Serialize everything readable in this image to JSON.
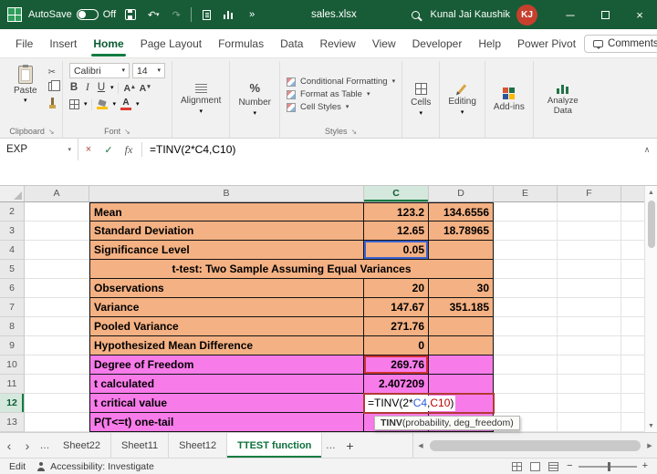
{
  "colors": {
    "titlebar_green": "#185C37",
    "accent_green": "#107C41",
    "orange_fill": "#F4B183",
    "pink_fill": "#F87BEA",
    "reference_blue": "#2E5BD7",
    "reference_red": "#C00000",
    "edit_border_red": "#B03A34",
    "avatar_red": "#C7402D"
  },
  "titlebar": {
    "autosave_label": "AutoSave",
    "autosave_state": "Off",
    "filename": "sales.xlsx",
    "user_name": "Kunal Jai Kaushik",
    "user_initials": "KJ"
  },
  "menubar": {
    "tabs": [
      "File",
      "Insert",
      "Home",
      "Page Layout",
      "Formulas",
      "Data",
      "Review",
      "View",
      "Developer",
      "Help",
      "Power Pivot"
    ],
    "active_tab": "Home",
    "comments_label": "Comments"
  },
  "ribbon": {
    "paste_label": "Paste",
    "clipboard_group_label": "Clipboard",
    "font_name": "Calibri",
    "font_size": "14",
    "bold_label": "B",
    "italic_label": "I",
    "underline_label": "U",
    "font_group_label": "Font",
    "alignment_label": "Alignment",
    "number_label": "Number",
    "percent_icon": "%",
    "styles_items": [
      "Conditional Formatting",
      "Format as Table",
      "Cell Styles"
    ],
    "styles_group_label": "Styles",
    "cells_label": "Cells",
    "editing_label": "Editing",
    "addins_label": "Add-ins",
    "addins_group_label": "Add-ins",
    "analyze_label": "Analyze Data"
  },
  "formula_bar": {
    "name_box": "EXP",
    "formula": "=TINV(2*C4,C10)"
  },
  "grid": {
    "column_headers": [
      "A",
      "B",
      "C",
      "D",
      "E",
      "F"
    ],
    "active_column": "C",
    "active_row": 12,
    "rows": [
      {
        "n": 2,
        "zone": "orange",
        "b": "Mean",
        "c": "123.2",
        "d": "134.6556"
      },
      {
        "n": 3,
        "zone": "orange",
        "b": "Standard Deviation",
        "c": "12.65",
        "d": "18.78965"
      },
      {
        "n": 4,
        "zone": "orange",
        "b": "Significance Level",
        "c": "0.05",
        "d": "",
        "c_ref": "blue"
      },
      {
        "n": 5,
        "zone": "orange",
        "merged": "t-test: Two Sample Assuming Equal Variances"
      },
      {
        "n": 6,
        "zone": "orange",
        "b": "Observations",
        "c": "20",
        "d": "30"
      },
      {
        "n": 7,
        "zone": "orange",
        "b": "Variance",
        "c": "147.67",
        "d": "351.185"
      },
      {
        "n": 8,
        "zone": "orange",
        "b": "Pooled Variance",
        "c": "271.76",
        "d": ""
      },
      {
        "n": 9,
        "zone": "orange",
        "b": "Hypothesized Mean Difference",
        "c": "0",
        "d": ""
      },
      {
        "n": 10,
        "zone": "pink",
        "b": "Degree of Freedom",
        "c": "269.76",
        "d": "",
        "c_ref": "red"
      },
      {
        "n": 11,
        "zone": "pink",
        "b": "t calculated",
        "c": "2.407209",
        "d": ""
      },
      {
        "n": 12,
        "zone": "pink",
        "b": "t critical value",
        "c": "",
        "d": "",
        "editing": true
      },
      {
        "n": 13,
        "zone": "pink",
        "b": "P(T<=t) one-tail",
        "c": "",
        "d": ""
      }
    ]
  },
  "cell_edit": {
    "parts": [
      {
        "text": "=TINV(2*",
        "color": "#000000"
      },
      {
        "text": "C4",
        "color": "#2E5BD7"
      },
      {
        "text": ",",
        "color": "#000000"
      },
      {
        "text": "C10",
        "color": "#C00000"
      },
      {
        "text": ")",
        "color": "#000000"
      }
    ]
  },
  "function_tooltip": {
    "fn": "TINV",
    "args": "(probability, deg_freedom)"
  },
  "sheet_bar": {
    "tabs": [
      "Sheet22",
      "Sheet11",
      "Sheet12",
      "TTEST function"
    ],
    "active": "TTEST function"
  },
  "status_bar": {
    "mode": "Edit",
    "accessibility": "Accessibility: Investigate"
  }
}
